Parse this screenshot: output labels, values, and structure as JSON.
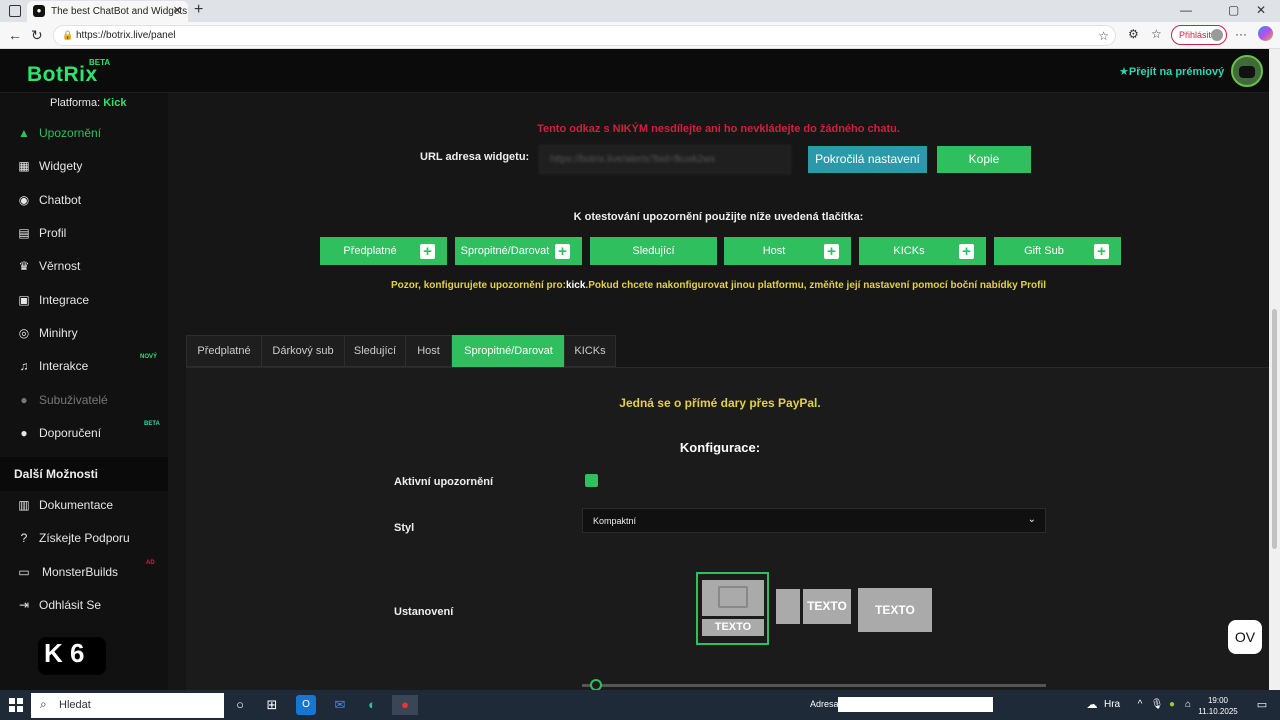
{
  "browser": {
    "tab_title": "The best ChatBot and Widgets fo",
    "address": "https://botrix.live/panel",
    "login_label": "Přihlásit"
  },
  "header": {
    "logo": "BotRix",
    "logo_badge": "BETA",
    "premium_label": "Přejít na prémiový"
  },
  "sidebar": {
    "platform_label": "Platforma:",
    "platform_value": "Kick",
    "items": [
      {
        "label": "Upozornění",
        "icon": "warning-icon"
      },
      {
        "label": "Widgety",
        "icon": "grid-icon"
      },
      {
        "label": "Chatbot",
        "icon": "robot-icon"
      },
      {
        "label": "Profil",
        "icon": "id-card-icon"
      },
      {
        "label": "Věrnost",
        "icon": "trophy-icon"
      },
      {
        "label": "Integrace",
        "icon": "integration-icon"
      },
      {
        "label": "Minihry",
        "icon": "gamepad-icon"
      },
      {
        "label": "Interakce",
        "icon": "music-icon",
        "badge": "NOVÝ"
      },
      {
        "label": "Subuživatelé",
        "icon": "users-icon"
      },
      {
        "label": "Doporučení",
        "icon": "user-group-icon",
        "badge": "BETA"
      }
    ],
    "more_heading": "Další Možnosti",
    "more_items": [
      {
        "label": "Dokumentace",
        "icon": "book-icon"
      },
      {
        "label": "Získejte Podporu",
        "icon": "question-icon"
      },
      {
        "label": "MonsterBuilds",
        "icon": "laptop-icon",
        "badge": "AD"
      },
      {
        "label": "Odhlásit Se",
        "icon": "logout-icon"
      }
    ],
    "kick_badge": "K 6"
  },
  "main": {
    "warning": "Tento odkaz s NIKÝM nesdílejte ani ho nevkládejte do žádného chatu.",
    "url_label": "URL adresa widgetu:",
    "url_value": "https://botrix.live/alerts?bid=fkuxk2wx",
    "advanced_button": "Pokročilá nastavení",
    "copy_button": "Kopie",
    "test_heading": "K otestování upozornění použijte níže uvedená tlačítka:",
    "test_buttons": [
      "Předplatné",
      "Spropitné/Darovat",
      "Sledující",
      "Host",
      "KICKs",
      "Gift Sub"
    ],
    "platform_note_pre": "Pozor, konfigurujete upozornění pro:",
    "platform_note_platform": "kick",
    "platform_note_post": ".Pokud chcete nakonfigurovat jinou platformu, změňte její nastavení pomocí boční nabídky Profil",
    "tabs": [
      "Předplatné",
      "Dárkový sub",
      "Sledující",
      "Host",
      "Spropitné/Darovat",
      "KICKs"
    ],
    "selected_tab": "Spropitné/Darovat",
    "paypal_note": "Jedná se o přímé dary přes PayPal.",
    "config_heading": "Konfigurace:",
    "active_alert_label": "Aktivní upozornění",
    "active_alert_checked": true,
    "style_label": "Styl",
    "style_value": "Kompaktní",
    "layout_label": "Ustanovení",
    "layout_text": "TEXTO"
  },
  "taskbar": {
    "search_label": "Hledat",
    "address_label": "Adresa",
    "weather_label": "Hra",
    "time": "19:00",
    "date": "11.10.2025"
  },
  "floating": {
    "ov_label": "OV"
  }
}
